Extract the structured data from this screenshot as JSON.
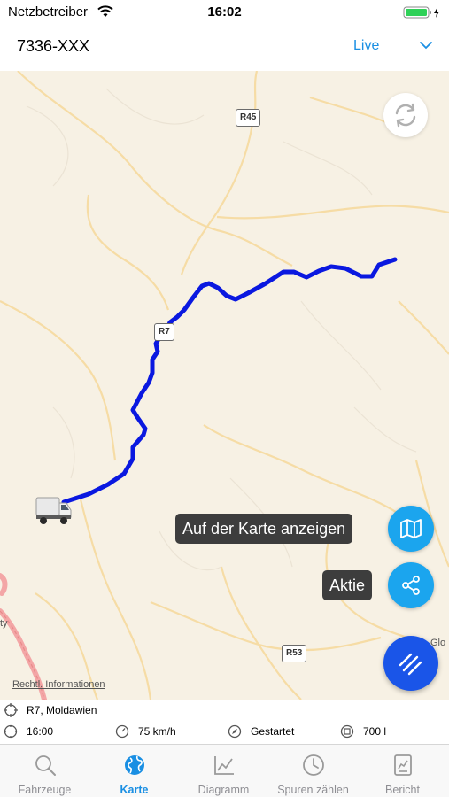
{
  "status_bar": {
    "carrier": "Netzbetreiber",
    "time": "16:02"
  },
  "header": {
    "title": "7336-XXX",
    "mode": "Live"
  },
  "map": {
    "road_labels": [
      "R45",
      "R7",
      "R53"
    ],
    "legal_link": "Rechtl. Informationen",
    "edge_labels": [
      "ty",
      "Glo"
    ]
  },
  "actions": {
    "show_on_map": "Auf der Karte anzeigen",
    "share": "Aktie"
  },
  "info": {
    "location": "R7, Moldawien",
    "time": "16:00",
    "speed": "75 km/h",
    "engine": "Gestartet",
    "fuel": "700 l"
  },
  "tabs": [
    {
      "label": "Fahrzeuge",
      "icon": "search-icon"
    },
    {
      "label": "Karte",
      "icon": "globe-icon",
      "active": true
    },
    {
      "label": "Diagramm",
      "icon": "chart-icon"
    },
    {
      "label": "Spuren zählen",
      "icon": "clock-icon"
    },
    {
      "label": "Bericht",
      "icon": "report-icon"
    }
  ],
  "colors": {
    "accent": "#1a8fe3",
    "route": "#0a18e0",
    "fab": "#1ba5ee",
    "menu_fab": "#1a55e8"
  }
}
